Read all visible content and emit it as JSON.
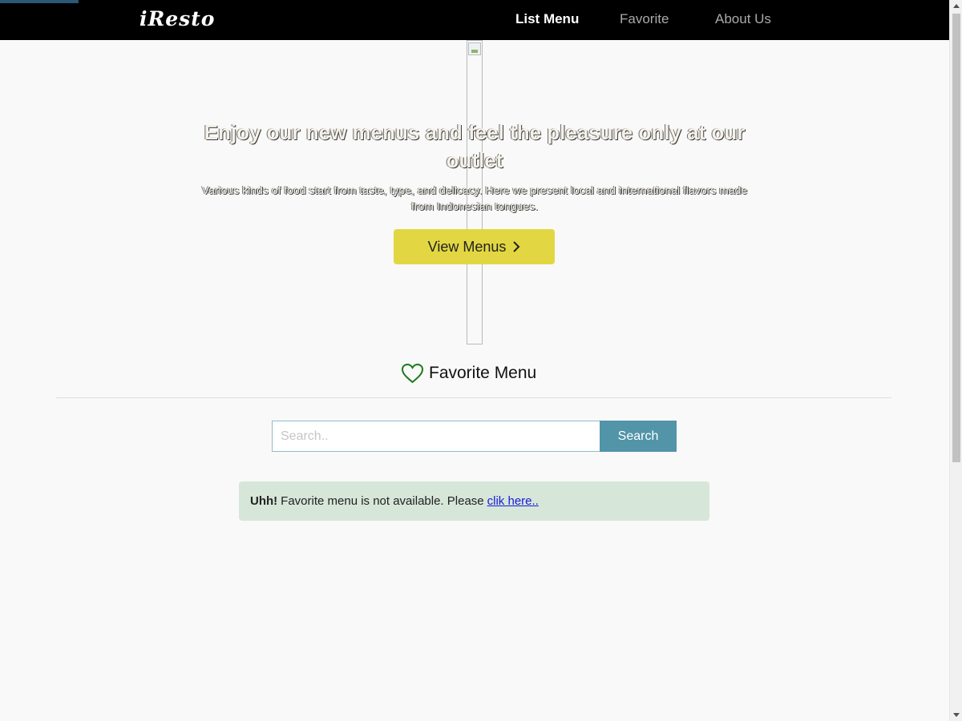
{
  "app": {
    "brand": "iResto"
  },
  "nav": {
    "items": [
      {
        "label": "List Menu",
        "active": true
      },
      {
        "label": "Favorite",
        "active": false
      },
      {
        "label": "About Us",
        "active": false
      }
    ]
  },
  "hero": {
    "title": "Enjoy our new menus and feel the pleasure only at our outlet",
    "subtitle": "Various kinds of food start from taste, type, and delicacy. Here we present local and international flavors made from Indonesian tongues.",
    "button_label": "View Menus",
    "button_icon": "chevron-right-icon",
    "button_color": "#e2d742"
  },
  "favorite": {
    "heading": "Favorite Menu",
    "heading_icon": "heart-icon",
    "icon_color": "#1b7a1b"
  },
  "search": {
    "placeholder": "Search..",
    "value": "",
    "button_label": "Search",
    "button_color": "#5294a8"
  },
  "alert": {
    "strong": "Uhh!",
    "message": "Favorite menu is not available. Please",
    "link": "clik here..",
    "background": "#d6e6d9"
  },
  "colors": {
    "navbar": "#000000",
    "page_background": "#f9f9f9"
  }
}
